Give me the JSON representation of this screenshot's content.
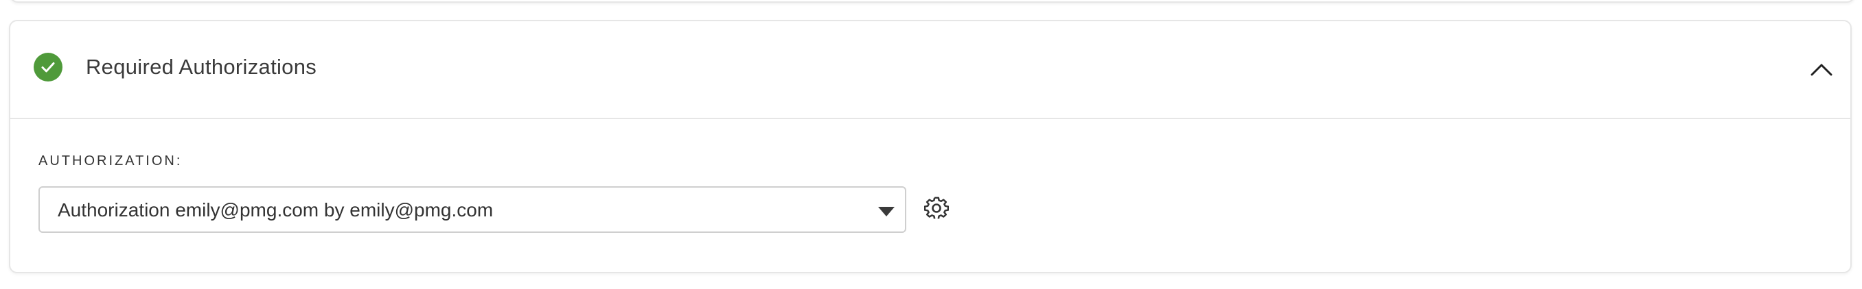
{
  "section": {
    "title": "Required Authorizations",
    "status": "complete",
    "status_color": "#4f9a3a",
    "expanded": true
  },
  "authorization": {
    "label": "AUTHORIZATION:",
    "selected_value": "Authorization emily@pmg.com by emily@pmg.com"
  },
  "icons": {
    "status": "check-circle-icon",
    "collapse": "chevron-up-icon",
    "dropdown": "caret-down-icon",
    "settings": "gear-icon"
  }
}
